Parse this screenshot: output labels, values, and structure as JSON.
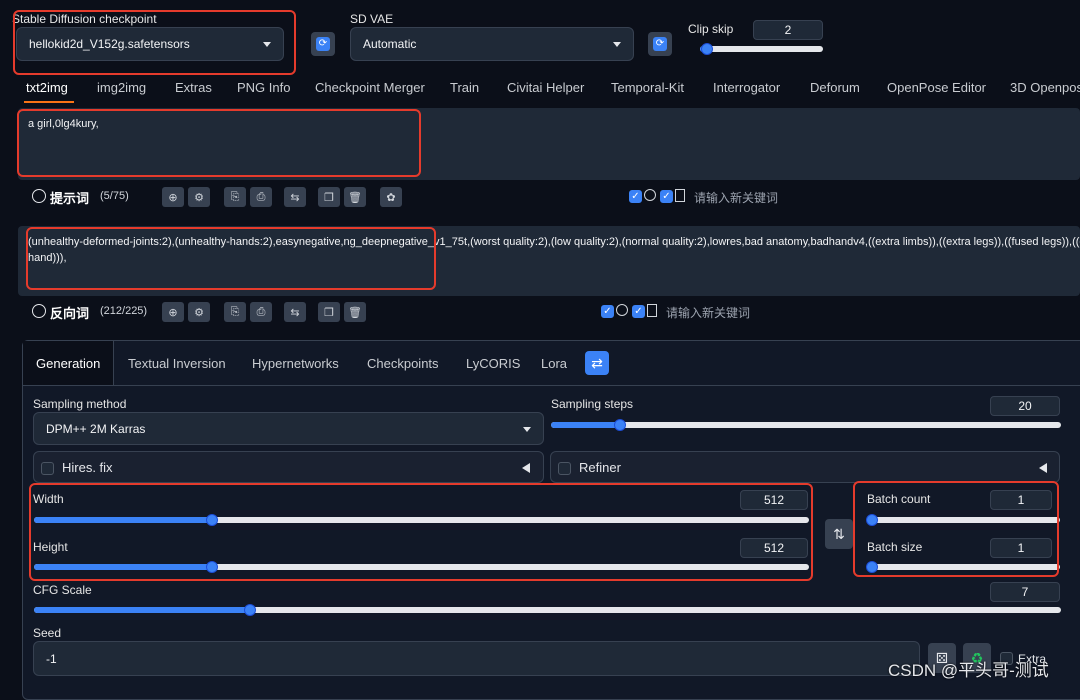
{
  "header": {
    "checkpoint_label": "Stable Diffusion checkpoint",
    "checkpoint_value": "hellokid2d_V152g.safetensors",
    "vae_label": "SD VAE",
    "vae_value": "Automatic",
    "clip_skip_label": "Clip skip",
    "clip_skip_value": "2",
    "refresh_glyph": "⟳"
  },
  "tabs": [
    {
      "label": "txt2img",
      "active": true
    },
    {
      "label": "img2img"
    },
    {
      "label": "Extras"
    },
    {
      "label": "PNG Info"
    },
    {
      "label": "Checkpoint Merger"
    },
    {
      "label": "Train"
    },
    {
      "label": "Civitai Helper"
    },
    {
      "label": "Temporal-Kit"
    },
    {
      "label": "Interrogator"
    },
    {
      "label": "Deforum"
    },
    {
      "label": "OpenPose Editor"
    },
    {
      "label": "3D Openpos"
    }
  ],
  "prompt": {
    "text": "a girl,0lg4kury,",
    "title": "提示词",
    "count": "(5/75)",
    "keyword_placeholder": "请输入新关键词"
  },
  "negative": {
    "text": "(unhealthy-deformed-joints:2),(unhealthy-hands:2),easynegative,ng_deepnegative_v1_75t,(worst quality:2),(low quality:2),(normal quality:2),lowres,bad anatomy,badhandv4,((extra limbs)),((extra legs)),((fused legs)),((extra arms)),((fused arms)),((extra hands)),((fused hands))),",
    "text_line2": "hand))),",
    "title": "反向词",
    "count": "(212/225)",
    "keyword_placeholder": "请输入新关键词"
  },
  "toolbar_glyphs": [
    "⊕",
    "⚙",
    "⎘",
    "⎙",
    "⇆",
    "❐",
    "🗑",
    "✿"
  ],
  "subtabs": [
    {
      "label": "Generation",
      "active": true
    },
    {
      "label": "Textual Inversion"
    },
    {
      "label": "Hypernetworks"
    },
    {
      "label": "Checkpoints"
    },
    {
      "label": "LyCORIS"
    },
    {
      "label": "Lora"
    }
  ],
  "generation": {
    "sampling_method_label": "Sampling method",
    "sampling_method_value": "DPM++ 2M Karras",
    "sampling_steps_label": "Sampling steps",
    "sampling_steps_value": "20",
    "hires_label": "Hires. fix",
    "refiner_label": "Refiner",
    "width_label": "Width",
    "width_value": "512",
    "height_label": "Height",
    "height_value": "512",
    "batch_count_label": "Batch count",
    "batch_count_value": "1",
    "batch_size_label": "Batch size",
    "batch_size_value": "1",
    "cfg_label": "CFG Scale",
    "cfg_value": "7",
    "seed_label": "Seed",
    "seed_value": "-1",
    "extra_label": "Extra",
    "swap_glyph": "⇅"
  },
  "watermark": "CSDN @平头哥-测试",
  "colors": {
    "accent": "#3b82f6",
    "highlight_box": "#e53b2c",
    "background": "#0b0f19"
  }
}
